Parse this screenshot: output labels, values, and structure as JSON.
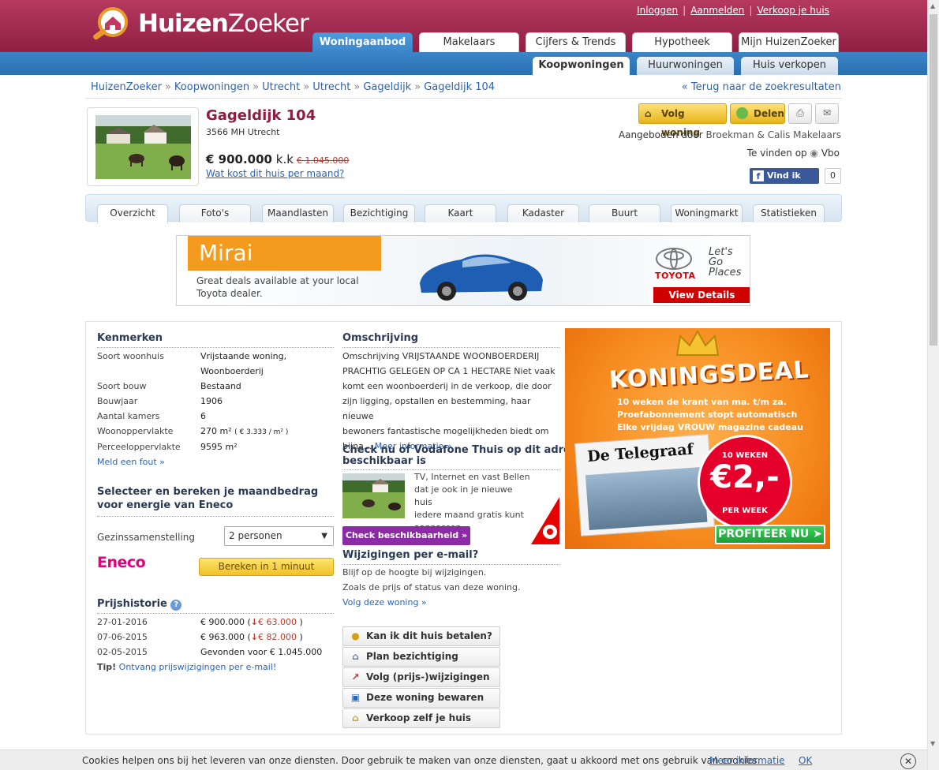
{
  "brand": {
    "logo_bold": "Huizen",
    "logo_light": "Zoeker"
  },
  "top_links": {
    "login": "Inloggen",
    "register": "Aanmelden",
    "sell": "Verkoop je huis"
  },
  "main_tabs": [
    "Woningaanbod",
    "Makelaars",
    "Cijfers & Trends",
    "Hypotheek",
    "Mijn HuizenZoeker"
  ],
  "sub_tabs": [
    "Koopwoningen",
    "Huurwoningen",
    "Huis verkopen"
  ],
  "breadcrumb": [
    "HuizenZoeker",
    "Koopwoningen",
    "Utrecht",
    "Utrecht",
    "Gageldijk",
    "Gageldijk 104"
  ],
  "breadcrumb_sep": "»",
  "back_link": "« Terug naar de zoekresultaten",
  "listing": {
    "street": "Gageldijk 104",
    "zip_city": "3566 MH Utrecht",
    "price": "€ 900.000",
    "price_suffix": "k.k",
    "old_price": "€ 1.045.000",
    "monthly_link": "Wat kost dit huis per maand?",
    "follow_btn": "Volg woning",
    "share_btn": "Delen",
    "offered_prefix": "Aangeboden door",
    "agent": "Broekman & Calis Makelaars",
    "found_prefix": "Te vinden op",
    "found_site": "Vbo",
    "fb_label": "Vind ik leuk",
    "fb_count": "0"
  },
  "detail_tabs": [
    "Overzicht",
    "Foto's",
    "Maandlasten",
    "Bezichtiging",
    "Kaart",
    "Kadaster",
    "Buurt",
    "Woningmarkt",
    "Statistieken"
  ],
  "ad_toyota": {
    "headline": "Mirai",
    "copy_1": "Great deals available at your local",
    "copy_2": "Toyota dealer.",
    "brand": "TOYOTA",
    "slogan_1": "Let's",
    "slogan_2": "Go",
    "slogan_3": "Places",
    "cta": "View Details"
  },
  "kenmerken": {
    "title": "Kenmerken",
    "rows": [
      {
        "label": "Soort woonhuis",
        "value": "Vrijstaande woning,"
      },
      {
        "label": "",
        "value": "Woonboerderij"
      },
      {
        "label": "Soort bouw",
        "value": "Bestaand"
      },
      {
        "label": "Bouwjaar",
        "value": "1906"
      },
      {
        "label": "Aantal kamers",
        "value": "6"
      },
      {
        "label": "Woonoppervlakte",
        "value": "270 m²"
      },
      {
        "label": "Perceeloppervlakte",
        "value": "9595 m²"
      }
    ],
    "price_per_m2": "( € 3.333 / m² )",
    "report_link": "Meld een fout »"
  },
  "eneco": {
    "title_1": "Selecteer en bereken je maandbedrag",
    "title_2": "voor energie van Eneco",
    "household_label": "Gezinssamenstelling",
    "household_value": "2 personen",
    "logo": "Eneco",
    "button": "Bereken in 1 minuut"
  },
  "price_history": {
    "title": "Prijshistorie",
    "rows": [
      {
        "date": "27-01-2016",
        "value": "€ 900.000 (",
        "change": "€ 63.000",
        "close": " )"
      },
      {
        "date": "07-06-2015",
        "value": "€ 963.000 (",
        "change": "€ 82.000",
        "close": " )"
      },
      {
        "date": "02-05-2015",
        "value": "Gevonden voor € 1.045.000",
        "change": "",
        "close": ""
      }
    ],
    "tip_label": "Tip!",
    "tip_link": "Ontvang prijswijzigingen per e-mail!"
  },
  "omschrijving": {
    "title": "Omschrijving",
    "lines": [
      "Omschrijving VRIJSTAANDE WOONBOERDERIJ",
      "PRACHTIG GELEGEN OP CA 1 HECTARE Niet vaak",
      "komt een woonboerderij in de verkoop, die door",
      "zijn ligging, opstallen en bestemming, haar nieuwe",
      "bewoners fantastische mogelijkheden biedt om"
    ],
    "last_line": "bijna...",
    "more_link": "Meer informatie »"
  },
  "vodafone": {
    "title_1": "Check nu of Vodafone Thuis op dit adres",
    "title_2": "beschikbaar is",
    "text_1": "TV, Internet en vast Bellen",
    "text_2": "dat je ook in je nieuwe huis",
    "text_3": "iedere maand gratis kunt",
    "text_4": "aanpassen",
    "button": "Check beschikbaarheid »"
  },
  "email": {
    "title": "Wijzigingen per e-mail?",
    "line_1": "Blijf op de hoogte bij wijzigingen.",
    "line_2": "Zoals de prijs of status van deze woning.",
    "link": "Volg deze woning »"
  },
  "actions": [
    "Kan ik dit huis betalen?",
    "Plan bezichtiging",
    "Volg (prijs-)wijzigingen",
    "Deze woning bewaren",
    "Verkoop zelf je huis"
  ],
  "ad_telegraaf": {
    "title": "KONINGSDEAL",
    "bullet_1": "10 weken de krant van ma. t/m za.",
    "bullet_2": "Proefabonnement stopt automatisch",
    "bullet_3": "Elke vrijdag VROUW magazine cadeau",
    "masthead": "De Telegraaf",
    "weeks": "10 WEKEN",
    "price": "€2,-",
    "per_week": "PER WEEK",
    "cta": "PROFITEER NU"
  },
  "cookie": {
    "message": "Cookies helpen ons bij het leveren van onze diensten. Door gebruik te maken van onze diensten, gaat u akkoord met ons gebruik van cookies.",
    "more": "Meer informatie",
    "ok": "OK",
    "close": "✕"
  },
  "colors": {
    "brand": "#8f1f43",
    "nav_blue": "#2a6fb0",
    "link": "#2a63b4",
    "accent_yellow": "#f0c12a",
    "vodafone_purple": "#8d2ba6"
  }
}
